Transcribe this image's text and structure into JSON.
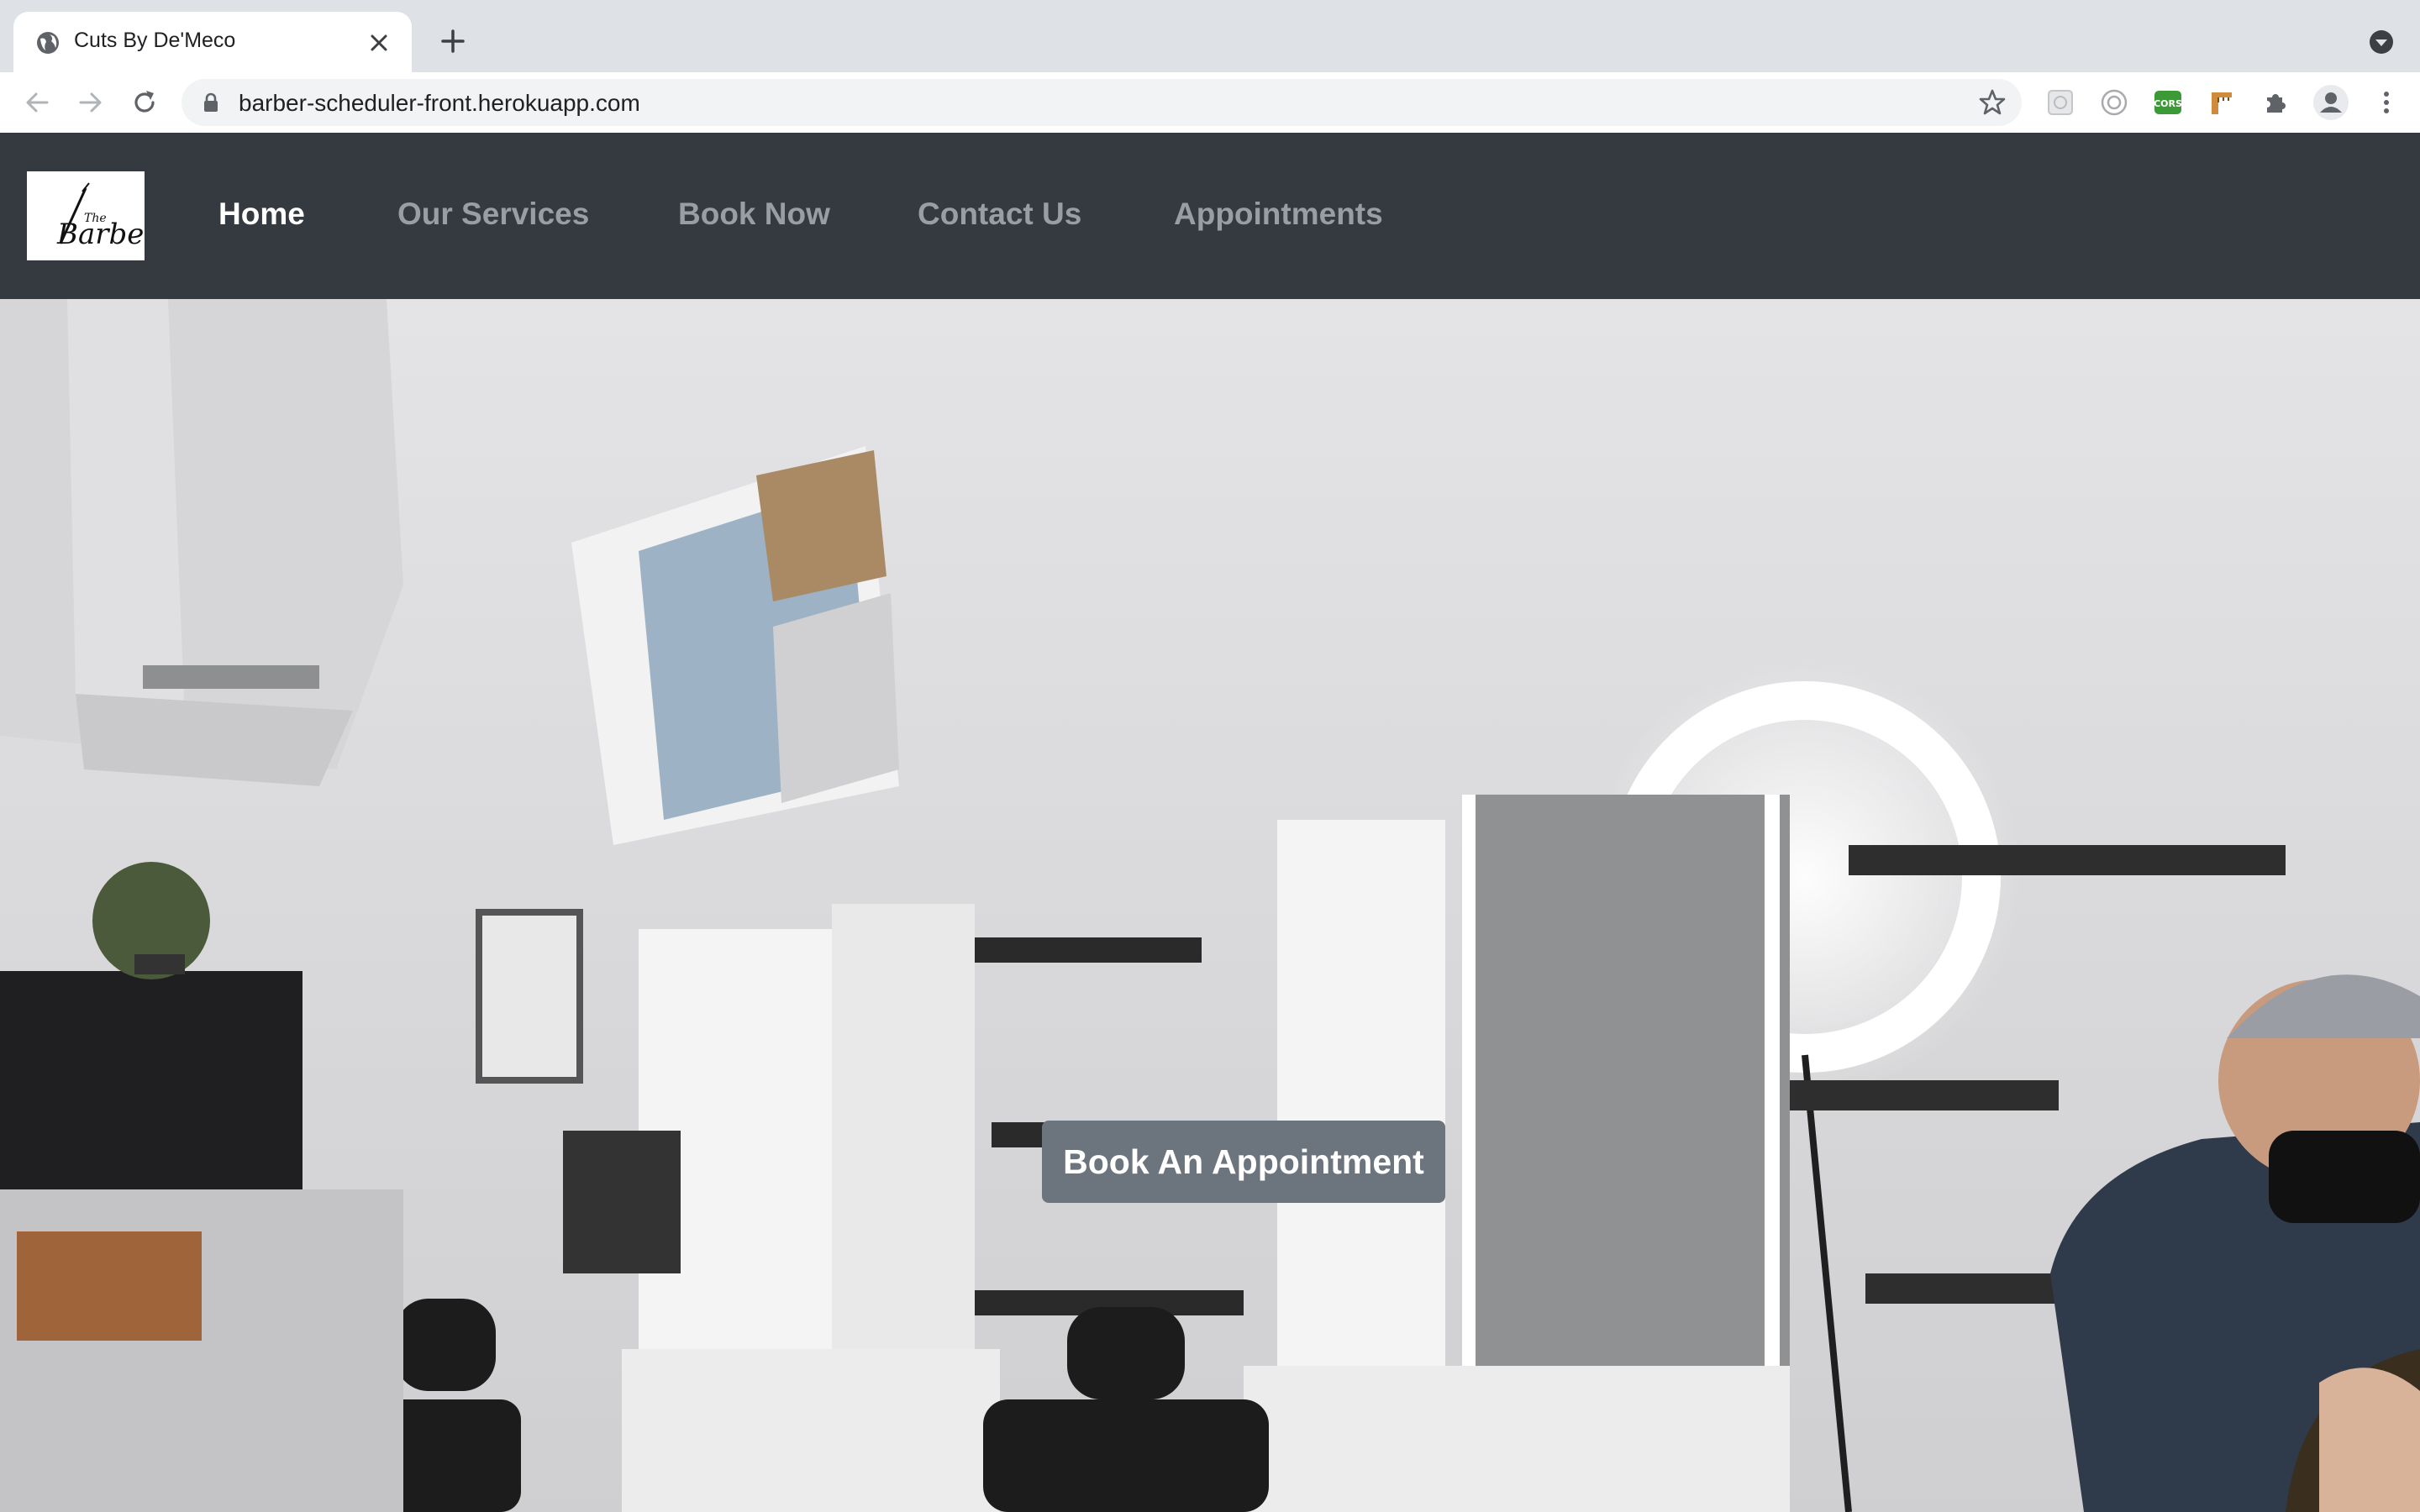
{
  "browser": {
    "tab": {
      "title": "Cuts By De'Meco",
      "favicon": "globe-icon"
    },
    "url": "barber-scheduler-front.herokuapp.com",
    "extensions": [
      "puzzle-extension-icon",
      "eye-extension-icon",
      "cors-extension-icon",
      "ruler-extension-icon",
      "extensions-puzzle-icon"
    ]
  },
  "site": {
    "logo_alt": "The Barber",
    "nav": {
      "home": "Home",
      "services": "Our Services",
      "book": "Book Now",
      "contact": "Contact Us",
      "appointments": "Appointments"
    },
    "hero_cta": "Book An Appointment"
  },
  "colors": {
    "navbar": "#343a40",
    "nav_active": "#ffffff",
    "nav_inactive": "#9a9da1",
    "cta_background": "#6c757d"
  }
}
